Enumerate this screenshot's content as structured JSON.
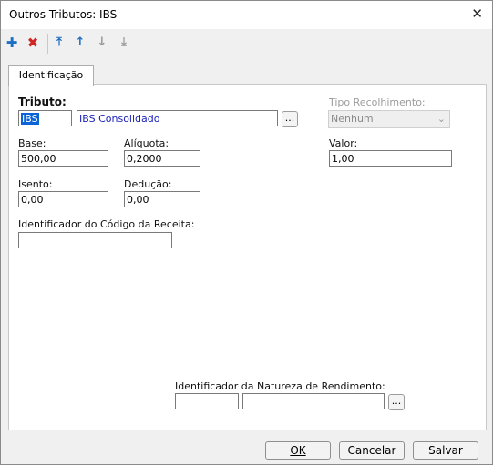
{
  "window": {
    "title": "Outros Tributos: IBS"
  },
  "toolbar": {
    "add_icon": "plus-icon",
    "delete_icon": "x-icon",
    "first_icon": "move-top-icon",
    "up_icon": "move-up-icon",
    "down_icon": "move-down-icon",
    "last_icon": "move-bottom-icon"
  },
  "tabs": [
    {
      "label": "Identificação"
    }
  ],
  "form": {
    "tributo_label": "Tributo:",
    "tributo_code": "IBS",
    "tributo_desc": "IBS Consolidado",
    "lookup_button": "...",
    "tipo_recolhimento_label": "Tipo Recolhimento:",
    "tipo_recolhimento_value": "Nenhum",
    "base_label": "Base:",
    "base_value": "500,00",
    "aliquota_label": "Alíquota:",
    "aliquota_value": "0,2000",
    "valor_label": "Valor:",
    "valor_value": "1,00",
    "isento_label": "Isento:",
    "isento_value": "0,00",
    "deducao_label": "Dedução:",
    "deducao_value": "0,00",
    "id_codigo_receita_label": "Identificador do Código da Receita:",
    "id_codigo_receita_value": "",
    "id_natureza_rendimento_label": "Identificador da Natureza de Rendimento:",
    "id_natureza_code": "",
    "id_natureza_desc": "",
    "natureza_lookup_button": "..."
  },
  "buttons": {
    "ok": "OK",
    "cancel": "Cancelar",
    "save": "Salvar"
  },
  "colors": {
    "selection": "#0a64d8",
    "link_text": "#1b22b8",
    "add": "#1d6fc4",
    "delete": "#d02626"
  }
}
